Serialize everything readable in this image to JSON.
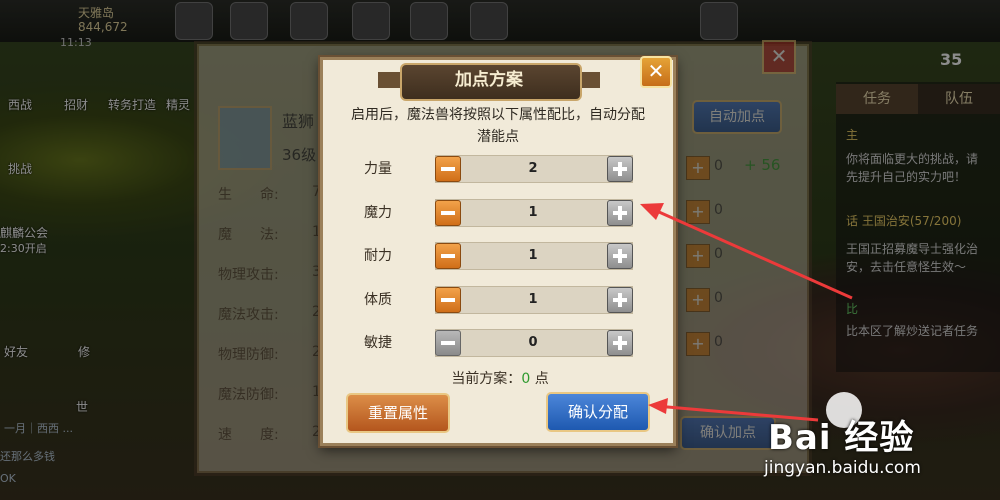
{
  "dialog": {
    "title": "加点方案",
    "description": "启用后，魔法兽将按照以下属性配比，自动分配潜能点",
    "close_glyph": "✕",
    "rows": [
      {
        "label": "力量",
        "value": "2",
        "minus_enabled": true
      },
      {
        "label": "魔力",
        "value": "1",
        "minus_enabled": true
      },
      {
        "label": "耐力",
        "value": "1",
        "minus_enabled": true
      },
      {
        "label": "体质",
        "value": "1",
        "minus_enabled": true
      },
      {
        "label": "敏捷",
        "value": "0",
        "minus_enabled": false
      }
    ],
    "scheme_label": "当前方案：",
    "scheme_value": "0",
    "scheme_unit": "点",
    "reset_button": "重置属性",
    "confirm_button": "确认分配"
  },
  "pet_panel": {
    "pet_name": "蓝狮",
    "pet_level": "36级",
    "auto_add_button": "自动加点",
    "confirm_add_button": "确认加点",
    "potential_gain": "+ 56",
    "stats": [
      {
        "label": "生　　命:",
        "value": "7"
      },
      {
        "label": "魔　　法:",
        "value": "1"
      },
      {
        "label": "物理攻击:",
        "value": "3"
      },
      {
        "label": "魔法攻击:",
        "value": "2"
      },
      {
        "label": "物理防御:",
        "value": "2"
      },
      {
        "label": "魔法防御:",
        "value": "1"
      },
      {
        "label": "速　　度:",
        "value": "2"
      }
    ],
    "right_zeros": [
      "0",
      "0",
      "0",
      "0",
      "0"
    ]
  },
  "top_bar": {
    "player": "天雅岛",
    "power": "844,672",
    "time": "11:13",
    "level_badge": "35"
  },
  "left_menu": [
    "西战",
    "招财",
    "转务打造",
    "精灵",
    "挑战",
    "麒麟公会",
    "2:30开启",
    "好友",
    "修",
    "世"
  ],
  "quest_panel": {
    "tabs": [
      "任务",
      "队伍"
    ],
    "lines": [
      "主",
      "你将面临更大的挑战，请",
      "先提升自己的实力吧！",
      "话  王国治安(57/200)",
      "王国正招募魔导士强化治",
      "安，去击任意怪生效～",
      "比",
      "比本区了解炒送记者任务"
    ]
  },
  "chat": {
    "lines": [
      "一月｜西西 ...",
      "还那么多钱",
      "OK"
    ]
  },
  "watermark": {
    "main": "Bai  经验",
    "sub": "jingyan.baidu.com"
  }
}
